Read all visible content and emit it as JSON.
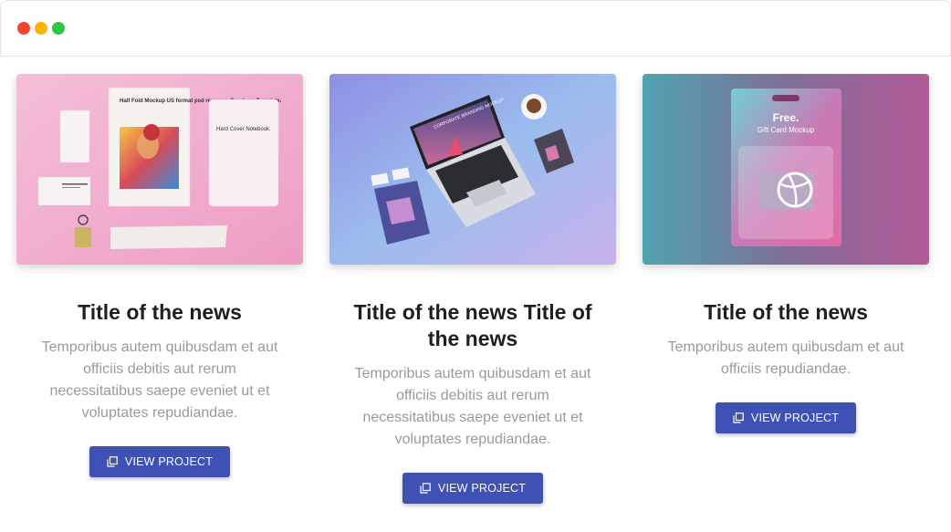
{
  "window": {
    "controls": [
      "close",
      "minimize",
      "maximize"
    ]
  },
  "cards": [
    {
      "image_alt": "Half Fold Mockup US format psd resource Brochure Template. Hard Cover Notebook.",
      "image_texts": {
        "brochure": "Half Fold Mockup US format psd resource Brochure Template.",
        "notebook": "Hard Cover Notebook."
      },
      "title": "Title of the news",
      "text": "Temporibus autem quibusdam et aut officiis debitis aut rerum necessitatibus saepe eveniet ut et voluptates repudiandae.",
      "button_label": "VIEW PROJECT",
      "button_icon": "copy-icon"
    },
    {
      "image_alt": "Corporate branding mockup with laptop",
      "image_texts": {
        "laptop": "CORPORATE BRANDING MOCKUP"
      },
      "title": "Title of the news Title of the news",
      "text": "Temporibus autem quibusdam et aut officiis debitis aut rerum necessitatibus saepe eveniet ut et voluptates repudiandae.",
      "button_label": "VIEW PROJECT",
      "button_icon": "copy-icon"
    },
    {
      "image_alt": "Free. Gift Card Mockup",
      "image_texts": {
        "free": "Free.",
        "gift": "Gift Card Mockup"
      },
      "title": "Title of the news",
      "text": "Temporibus autem quibusdam et aut officiis repudiandae.",
      "button_label": "VIEW PROJECT",
      "button_icon": "copy-icon"
    }
  ],
  "colors": {
    "button": "#3f51b5",
    "title": "#1f1f1f",
    "text": "#9a9a9a"
  }
}
